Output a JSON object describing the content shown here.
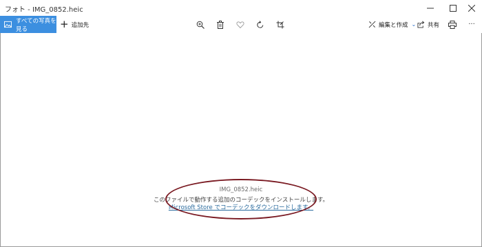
{
  "titlebar": {
    "title": "フォト - IMG_0852.heic",
    "minimize_icon": "minimize-icon",
    "maximize_icon": "maximize-icon",
    "close_icon": "close-icon"
  },
  "toolbar": {
    "all_photos_label": "すべての写真を見る",
    "add_to_label": "追加先",
    "zoom_icon": "zoom-in-icon",
    "delete_icon": "trash-icon",
    "favorite_icon": "heart-icon",
    "rotate_icon": "rotate-icon",
    "crop_icon": "crop-icon",
    "edit_label": "編集と作成",
    "share_label": "共有",
    "print_icon": "print-icon",
    "more_label": "···"
  },
  "message": {
    "file_name": "IMG_0852.heic",
    "description": "このファイルで動作する追加のコーデックをインストールします。",
    "link_text": "Microsoft Store でコーデックをダウンロードします。"
  },
  "colors": {
    "accent": "#3c8fe0",
    "link": "#2a6b9e",
    "annotation": "#7a1a22"
  }
}
